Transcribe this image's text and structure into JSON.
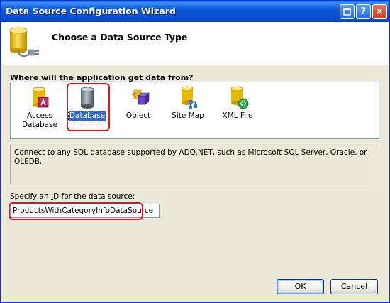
{
  "window": {
    "title": "Data Source Configuration Wizard"
  },
  "titlebar": {
    "help_glyph": "?",
    "close_glyph": "×"
  },
  "header": {
    "title": "Choose a Data Source Type",
    "icon": "database-plug-icon"
  },
  "question": "Where will the application get data from?",
  "types": [
    {
      "label_line1": "Access",
      "label_line2": "Database",
      "icon": "access-database-icon"
    },
    {
      "label": "Database",
      "icon": "database-icon",
      "selected": true
    },
    {
      "label": "Object",
      "icon": "object-icon"
    },
    {
      "label": "Site Map",
      "icon": "site-map-icon"
    },
    {
      "label": "XML File",
      "icon": "xml-file-icon"
    }
  ],
  "description": "Connect to any SQL database supported by ADO.NET, such as Microsoft SQL Server, Oracle, or OLEDB.",
  "id_field": {
    "label_prefix": "Specify an ",
    "label_accel": "I",
    "label_suffix": "D for the data source:",
    "value": "ProductsWithCategoryInfoDataSource"
  },
  "buttons": {
    "ok": "OK",
    "cancel": "Cancel"
  },
  "colors": {
    "highlight_ring": "#e8101c",
    "selection": "#316ac5",
    "titlebar": "#0c59d8"
  }
}
